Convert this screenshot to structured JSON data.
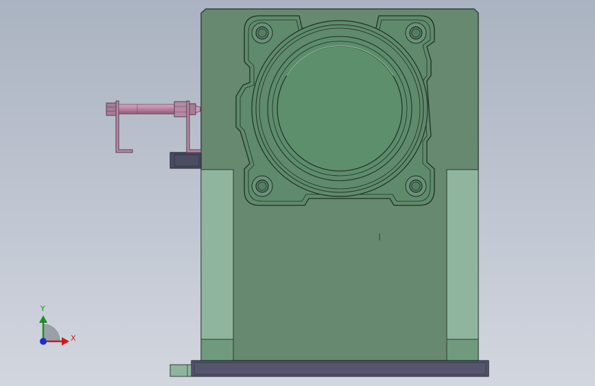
{
  "viewport": {
    "background_top": "#aab3c1",
    "background_bottom": "#d2d6df"
  },
  "triad": {
    "x_label": "X",
    "y_label": "Y",
    "x_color": "#d01818",
    "y_color": "#1f8f1f",
    "origin_color": "#1a2bd0"
  },
  "colors": {
    "housing": "#67896f",
    "housing_edge": "#1f2f22",
    "flange_face": "#5e8f6c",
    "light_panel": "#8fb59f",
    "base_plate": "#55556e",
    "bracket": "#4c4c62",
    "shaft": "#b9809f",
    "shaft_dark": "#6e4a5f"
  }
}
